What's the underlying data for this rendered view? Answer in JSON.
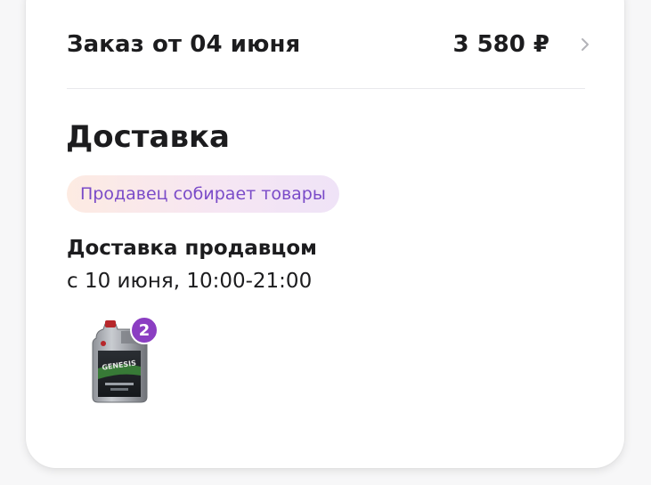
{
  "order": {
    "title": "Заказ от 04 июня",
    "total": "3 580 ₽",
    "chevron_icon": "chevron-right-icon"
  },
  "delivery": {
    "section_title": "Доставка",
    "status": "Продавец собирает товары",
    "method": "Доставка продавцом",
    "time": "с 10 июня, 10:00-21:00"
  },
  "items": [
    {
      "image": "motor-oil-canister-image",
      "quantity": "2"
    }
  ],
  "colors": {
    "status_text": "#7a4bc8",
    "badge_bg": "#8b3ec2",
    "text": "#1c1c1e"
  }
}
